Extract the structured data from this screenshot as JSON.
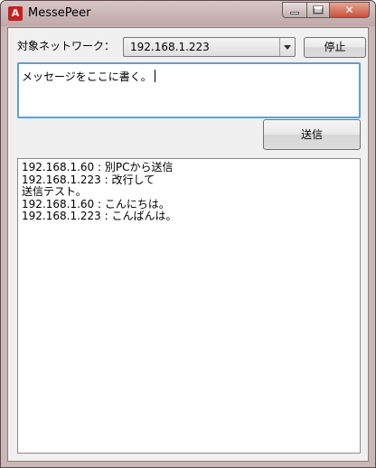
{
  "window": {
    "title": "MessePeer",
    "icon": "app-icon",
    "icon_glyph": "A",
    "accent": "#c82020"
  },
  "toolbar": {
    "network_label": "対象ネットワーク：",
    "network_selected": "192.168.1.223",
    "stop_label": "停止"
  },
  "compose": {
    "message_value": "メッセージをここに書く。",
    "send_label": "送信"
  },
  "log": {
    "lines": [
      "192.168.1.60 : 別PCから送信",
      "192.168.1.223 : 改行して",
      "送信テスト。",
      "192.168.1.60 : こんにちは。",
      "192.168.1.223 : こんばんは。"
    ]
  }
}
